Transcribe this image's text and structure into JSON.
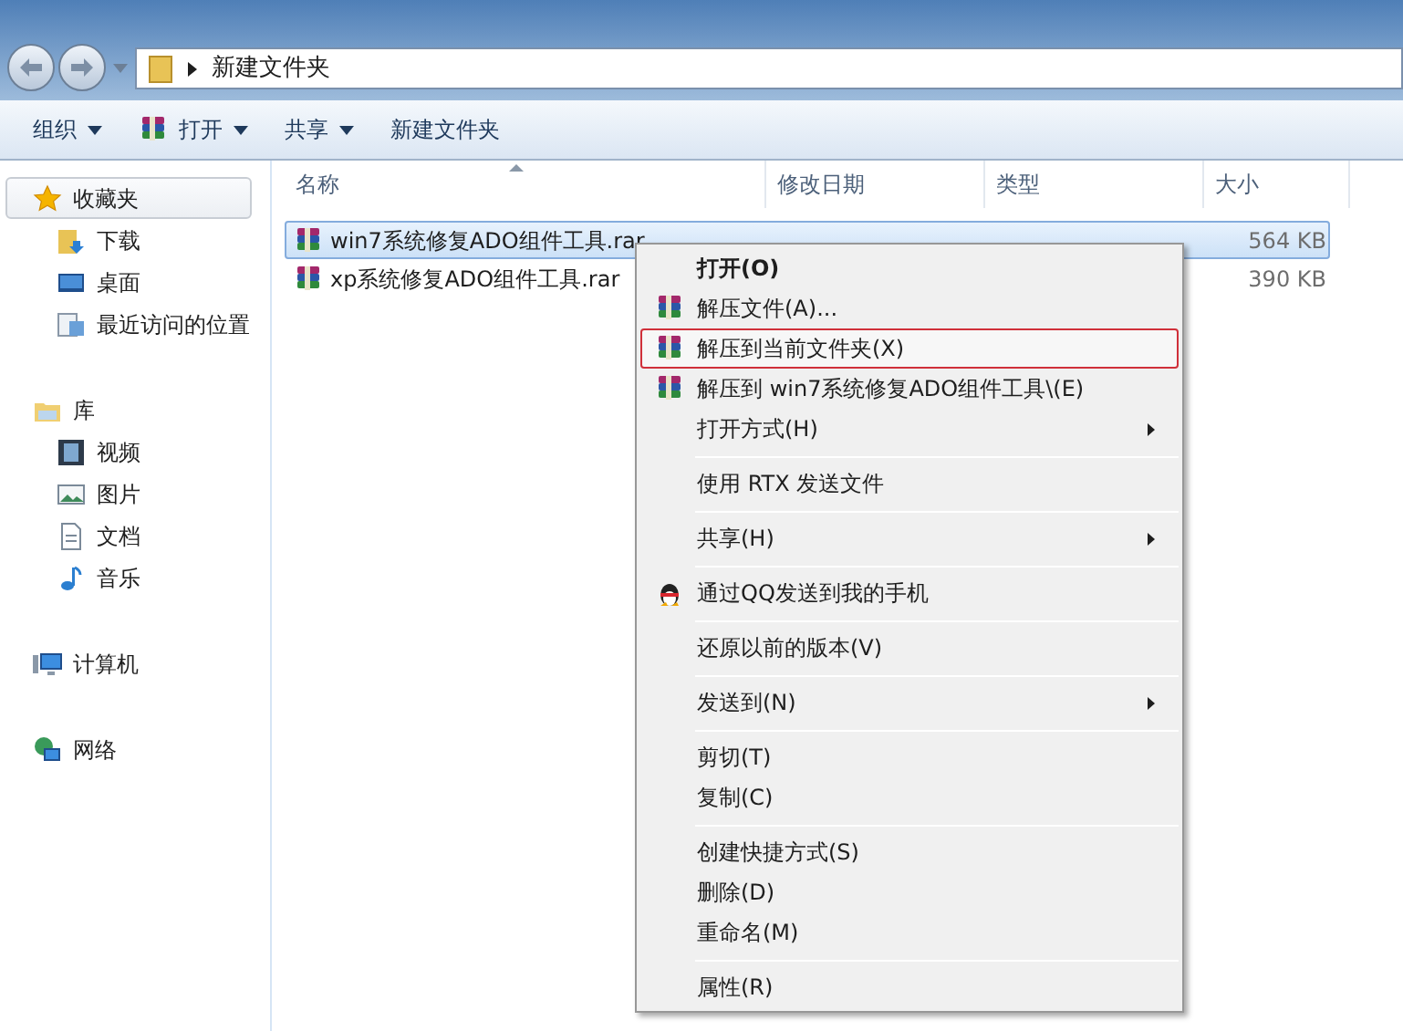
{
  "address_bar": {
    "path": "新建文件夹"
  },
  "toolbar": [
    {
      "label": "组织",
      "kind": "dropdown"
    },
    {
      "label": "打开",
      "kind": "dropdown-archive"
    },
    {
      "label": "共享",
      "kind": "dropdown"
    },
    {
      "label": "新建文件夹",
      "kind": "plain"
    }
  ],
  "sidebar": {
    "groups": [
      {
        "label": "收藏夹",
        "selected": true,
        "children": [
          {
            "label": "下载"
          },
          {
            "label": "桌面"
          },
          {
            "label": "最近访问的位置"
          }
        ]
      },
      {
        "label": "库",
        "selected": false,
        "children": [
          {
            "label": "视频"
          },
          {
            "label": "图片"
          },
          {
            "label": "文档"
          },
          {
            "label": "音乐"
          }
        ]
      },
      {
        "label": "计算机",
        "selected": false
      },
      {
        "label": "网络",
        "selected": false
      }
    ]
  },
  "table": {
    "columns": [
      "名称",
      "修改日期",
      "类型",
      "大小"
    ],
    "rows": [
      {
        "name": "win7系统修复ADO组件工具.rar",
        "size": "564 KB",
        "selected": true
      },
      {
        "name": "xp系统修复ADO组件工具.rar",
        "size": "390 KB",
        "selected": false
      }
    ]
  },
  "context_menu": [
    {
      "label": "打开(O)",
      "kind": "default",
      "highlighted": false
    },
    {
      "label": "解压文件(A)...",
      "kind": "archive",
      "highlighted": false
    },
    {
      "label": "解压到当前文件夹(X)",
      "kind": "archive",
      "highlighted": true
    },
    {
      "label": "解压到 win7系统修复ADO组件工具\\(E)",
      "kind": "archive",
      "highlighted": false
    },
    {
      "label": "打开方式(H)",
      "kind": "submenu",
      "highlighted": false
    },
    {
      "kind": "separator"
    },
    {
      "label": "使用 RTX 发送文件",
      "kind": "plain",
      "highlighted": false
    },
    {
      "kind": "separator"
    },
    {
      "label": "共享(H)",
      "kind": "submenu",
      "highlighted": false
    },
    {
      "kind": "separator"
    },
    {
      "label": "通过QQ发送到我的手机",
      "kind": "qq",
      "highlighted": false
    },
    {
      "kind": "separator"
    },
    {
      "label": "还原以前的版本(V)",
      "kind": "plain",
      "highlighted": false
    },
    {
      "kind": "separator"
    },
    {
      "label": "发送到(N)",
      "kind": "submenu",
      "highlighted": false
    },
    {
      "kind": "separator"
    },
    {
      "label": "剪切(T)",
      "kind": "plain",
      "highlighted": false
    },
    {
      "label": "复制(C)",
      "kind": "plain",
      "highlighted": false
    },
    {
      "kind": "separator"
    },
    {
      "label": "创建快捷方式(S)",
      "kind": "plain",
      "highlighted": false
    },
    {
      "label": "删除(D)",
      "kind": "plain",
      "highlighted": false
    },
    {
      "label": "重命名(M)",
      "kind": "plain",
      "highlighted": false
    },
    {
      "kind": "separator"
    },
    {
      "label": "属性(R)",
      "kind": "plain",
      "highlighted": false
    }
  ]
}
